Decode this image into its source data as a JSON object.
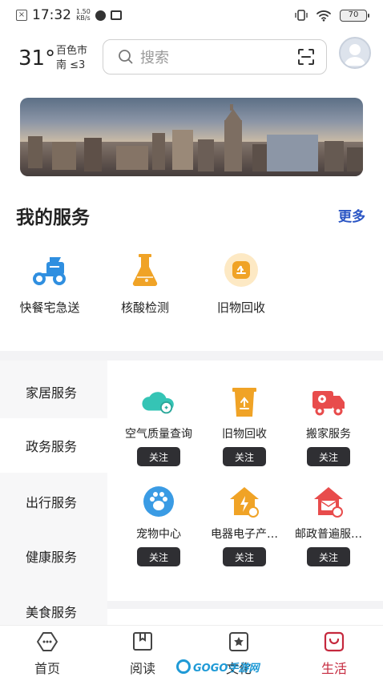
{
  "status_bar": {
    "time": "17:32",
    "speed_value": "1.50",
    "speed_unit": "KB/s",
    "battery": "70"
  },
  "header": {
    "temperature": "31°",
    "city": "百色市",
    "wind": "南 ≤3",
    "search_placeholder": "搜索"
  },
  "my_services": {
    "title": "我的服务",
    "more_label": "更多",
    "items": [
      {
        "label": "快餐宅急送",
        "icon": "delivery-scooter-icon"
      },
      {
        "label": "核酸检测",
        "icon": "flask-icon"
      },
      {
        "label": "旧物回收",
        "icon": "recycle-bin-icon"
      }
    ]
  },
  "categories": [
    {
      "label": "家居服务",
      "active": false
    },
    {
      "label": "政务服务",
      "active": true
    },
    {
      "label": "出行服务",
      "active": false
    },
    {
      "label": "健康服务",
      "active": false
    },
    {
      "label": "美食服务",
      "active": false
    }
  ],
  "grid_items": [
    {
      "label": "空气质量查询",
      "follow": "关注",
      "icon": "cloud-air-icon"
    },
    {
      "label": "旧物回收",
      "follow": "关注",
      "icon": "recycle-bin-icon"
    },
    {
      "label": "搬家服务",
      "follow": "关注",
      "icon": "moving-truck-icon"
    },
    {
      "label": "宠物中心",
      "follow": "关注",
      "icon": "paw-icon"
    },
    {
      "label": "电器电子产…",
      "follow": "关注",
      "icon": "electric-home-icon"
    },
    {
      "label": "邮政普遍服…",
      "follow": "关注",
      "icon": "mail-home-icon"
    }
  ],
  "bottom_nav": [
    {
      "label": "首页",
      "icon": "home-chat-icon",
      "active": false
    },
    {
      "label": "阅读",
      "icon": "book-icon",
      "active": false
    },
    {
      "label": "文化",
      "icon": "star-box-icon",
      "active": false
    },
    {
      "label": "生活",
      "icon": "bag-smile-icon",
      "active": true
    }
  ],
  "watermark": "GOGO手游网",
  "colors": {
    "accent_red": "#c5283d",
    "link_blue": "#2a55c4",
    "follow_btn": "#2f2f33"
  }
}
